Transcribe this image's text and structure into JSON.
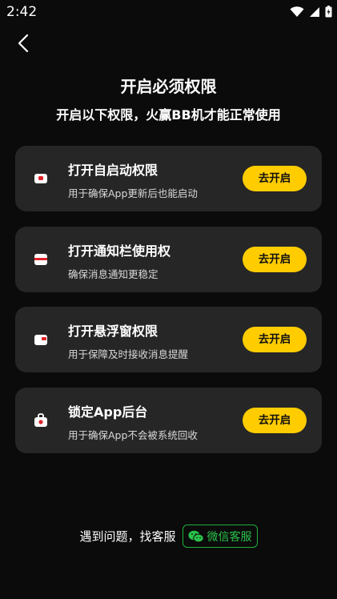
{
  "status_bar": {
    "time": "2:42"
  },
  "header": {
    "title": "开启必须权限",
    "subtitle": "开启以下权限，火赢BB机才能正常使用"
  },
  "permissions": [
    {
      "title": "打开自启动权限",
      "description": "用于确保App更新后也能启动",
      "button": "去开启",
      "icon": "autostart-icon"
    },
    {
      "title": "打开通知栏使用权",
      "description": "确保消息通知更稳定",
      "button": "去开启",
      "icon": "notification-icon"
    },
    {
      "title": "打开悬浮窗权限",
      "description": "用于保障及时接收消息提醒",
      "button": "去开启",
      "icon": "floating-window-icon"
    },
    {
      "title": "锁定App后台",
      "description": "用于确保App不会被系统回收",
      "button": "去开启",
      "icon": "lock-app-icon"
    }
  ],
  "help": {
    "text": "遇到问题，找客服",
    "wechat_label": "微信客服"
  },
  "colors": {
    "accent": "#ffcc00",
    "wechat": "#29c24a",
    "card": "#262626",
    "background": "#0b0b0b"
  }
}
